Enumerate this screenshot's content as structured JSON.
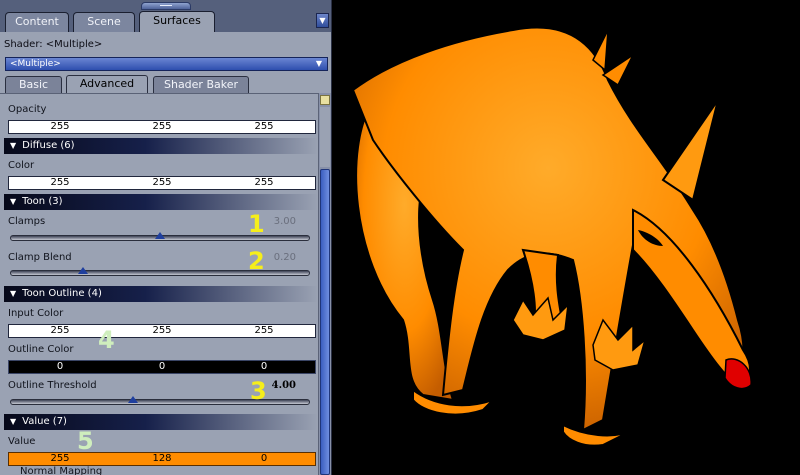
{
  "tabs": [
    {
      "label": "Content"
    },
    {
      "label": "Scene"
    },
    {
      "label": "Surfaces"
    }
  ],
  "shader": {
    "label": "Shader: <Multiple>",
    "value": "<Multiple>"
  },
  "subtabs": [
    {
      "label": "Basic"
    },
    {
      "label": "Advanced"
    },
    {
      "label": "Shader Baker"
    }
  ],
  "props": {
    "opacity": {
      "label": "Opacity",
      "values": [
        "255",
        "255",
        "255"
      ]
    },
    "diffuse_group": "Diffuse (6)",
    "color": {
      "label": "Color",
      "values": [
        "255",
        "255",
        "255"
      ]
    },
    "toon_group": "Toon (3)",
    "clamps": {
      "label": "Clamps",
      "value": "3.00",
      "position": 0.5
    },
    "clamp_blend": {
      "label": "Clamp Blend",
      "value": "0.20",
      "position": 0.24
    },
    "toon_outline_group": "Toon Outline (4)",
    "input_color": {
      "label": "Input Color",
      "values": [
        "255",
        "255",
        "255"
      ]
    },
    "outline_color": {
      "label": "Outline Color",
      "values": [
        "0",
        "0",
        "0"
      ]
    },
    "outline_threshold": {
      "label": "Outline Threshold",
      "value": "4.00",
      "position": 0.41
    },
    "value_group": "Value (7)",
    "value": {
      "label": "Value",
      "values": [
        "255",
        "128",
        "0"
      ]
    },
    "next_group": "Normal Mapping"
  },
  "annotations": [
    "1",
    "2",
    "3",
    "4",
    "5"
  ],
  "colors": {
    "panel": "#9aa2b3",
    "accent_blue": "#2e4fae",
    "creature_orange": "#ff8c00",
    "annotation_yellow": "#f6ee1a",
    "annotation_mint": "#cfeebd"
  }
}
